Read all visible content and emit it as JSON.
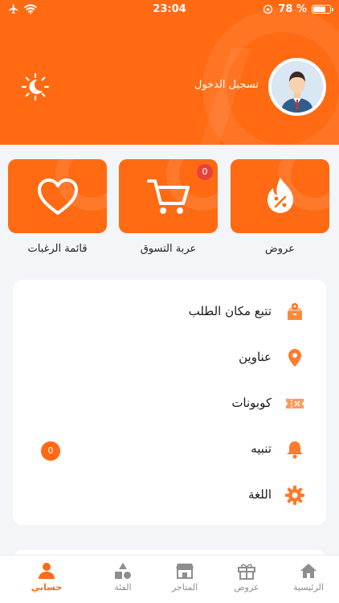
{
  "status_bar": {
    "time": "23:04",
    "battery": "78 %",
    "battery_level": 0.78
  },
  "header": {
    "login_text": "تسجيل الدخول"
  },
  "shortcuts": [
    {
      "label": "عروض",
      "icon": "fire-discount-icon"
    },
    {
      "label": "عربة التسوق",
      "icon": "cart-icon",
      "badge": "0"
    },
    {
      "label": "قائمة الرغبات",
      "icon": "heart-icon"
    }
  ],
  "menu": [
    {
      "label": "تتبع مكان الطلب",
      "icon": "track-box-icon"
    },
    {
      "label": "عناوين",
      "icon": "location-pin-icon"
    },
    {
      "label": "كوبونات",
      "icon": "coupon-icon"
    },
    {
      "label": "تنبيه",
      "icon": "bell-icon",
      "badge": "0"
    },
    {
      "label": "اللغة",
      "icon": "gear-icon"
    }
  ],
  "tabs": [
    {
      "label": "الرئيسية",
      "icon": "home-icon"
    },
    {
      "label": "عروض",
      "icon": "gift-icon"
    },
    {
      "label": "المتاجر",
      "icon": "store-icon"
    },
    {
      "label": "الفئة",
      "icon": "category-shapes-icon"
    },
    {
      "label": "حسابي",
      "icon": "person-icon",
      "active": true
    }
  ],
  "colors": {
    "accent": "#ff6a12",
    "badge_red": "#e8423a",
    "background": "#f3f5f9"
  }
}
